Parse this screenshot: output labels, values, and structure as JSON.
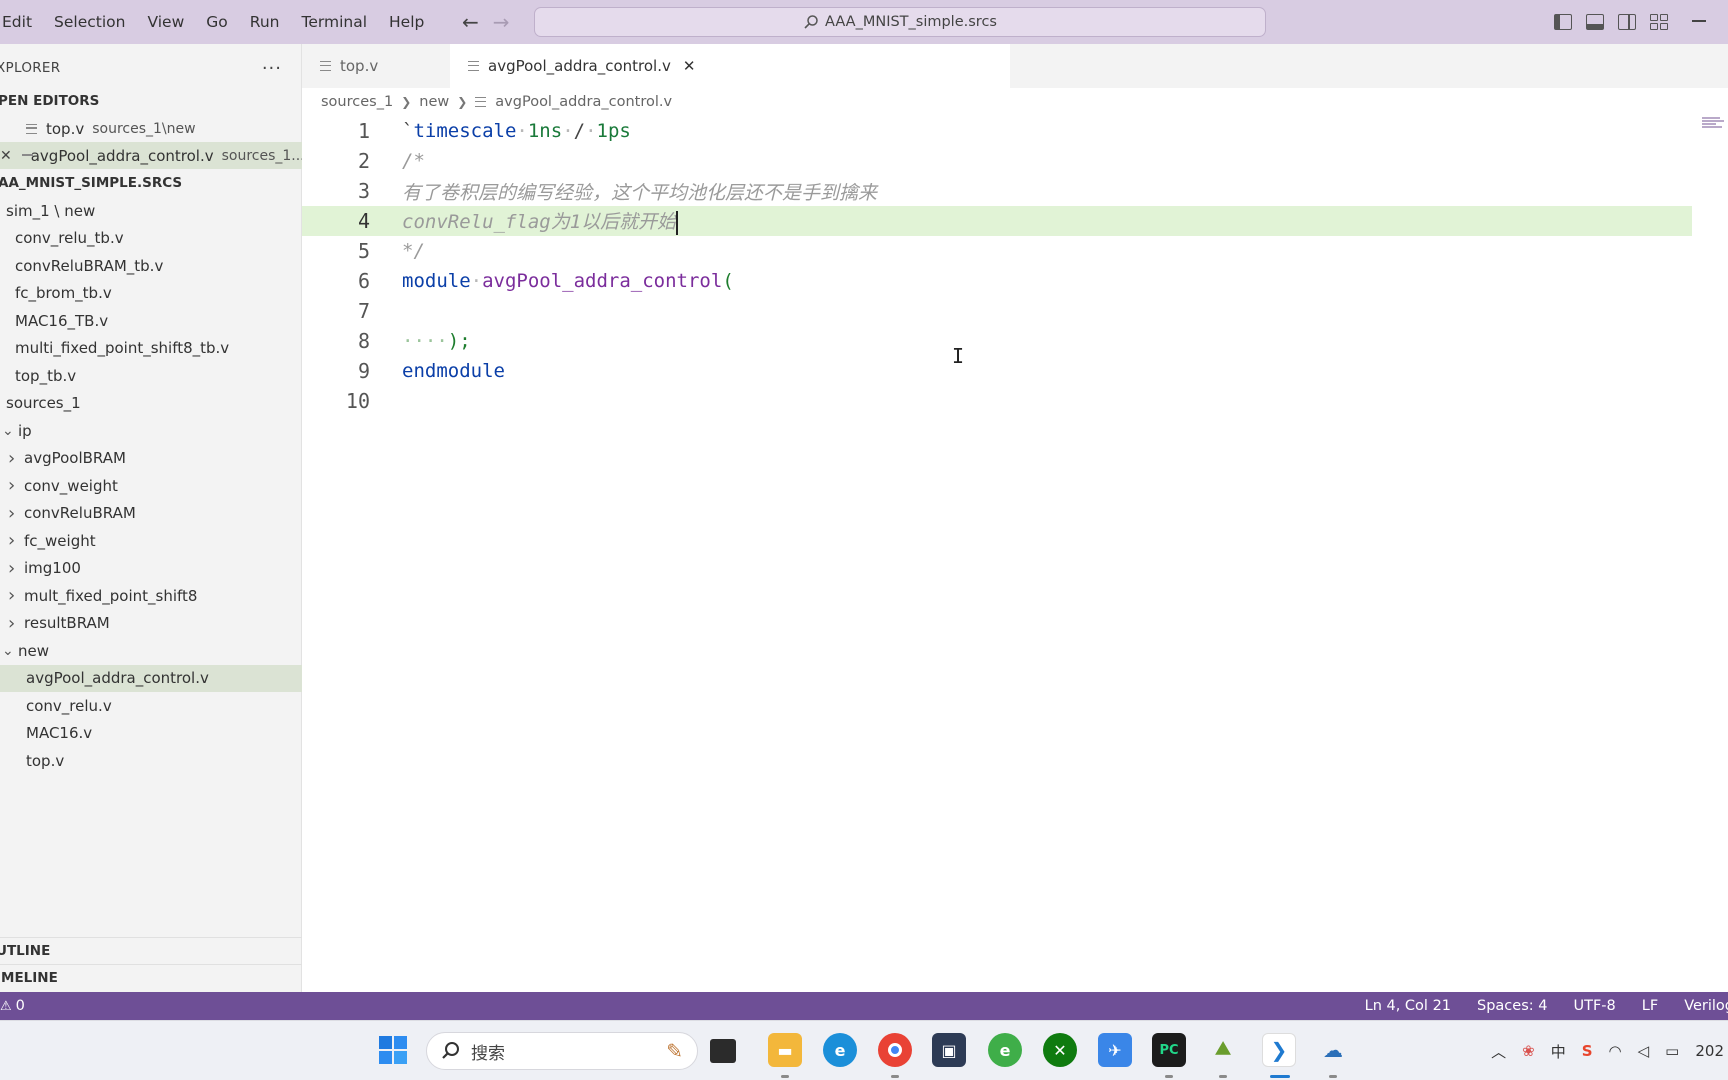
{
  "menu": [
    "Edit",
    "Selection",
    "View",
    "Go",
    "Run",
    "Terminal",
    "Help"
  ],
  "command_center": {
    "text": "AAA_MNIST_simple.srcs"
  },
  "sidebar": {
    "title": "XPLORER",
    "more": "···",
    "open_editors_label": "PEN EDITORS",
    "open_editors": [
      {
        "name": "top.v",
        "desc": "sources_1\\new"
      },
      {
        "name": "avgPool_addra_control.v",
        "desc": "sources_1..."
      }
    ],
    "workspace_label": "AA_MNIST_SIMPLE.SRCS",
    "tree": [
      {
        "label": "sim_1 \\ new",
        "indent": 6,
        "type": "folder-plain"
      },
      {
        "label": "conv_relu_tb.v",
        "indent": 15,
        "type": "file"
      },
      {
        "label": "convReluBRAM_tb.v",
        "indent": 15,
        "type": "file"
      },
      {
        "label": "fc_brom_tb.v",
        "indent": 15,
        "type": "file"
      },
      {
        "label": "MAC16_TB.v",
        "indent": 15,
        "type": "file"
      },
      {
        "label": "multi_fixed_point_shift8_tb.v",
        "indent": 15,
        "type": "file"
      },
      {
        "label": "top_tb.v",
        "indent": 15,
        "type": "file"
      },
      {
        "label": "sources_1",
        "indent": 6,
        "type": "folder-plain"
      },
      {
        "label": "ip",
        "indent": 2,
        "type": "folder-open"
      },
      {
        "label": "avgPoolBRAM",
        "indent": 8,
        "type": "folder-closed"
      },
      {
        "label": "conv_weight",
        "indent": 8,
        "type": "folder-closed"
      },
      {
        "label": "convReluBRAM",
        "indent": 8,
        "type": "folder-closed"
      },
      {
        "label": "fc_weight",
        "indent": 8,
        "type": "folder-closed"
      },
      {
        "label": "img100",
        "indent": 8,
        "type": "folder-closed"
      },
      {
        "label": "mult_fixed_point_shift8",
        "indent": 8,
        "type": "folder-closed"
      },
      {
        "label": "resultBRAM",
        "indent": 8,
        "type": "folder-closed"
      },
      {
        "label": "new",
        "indent": 2,
        "type": "folder-open"
      },
      {
        "label": "avgPool_addra_control.v",
        "indent": 26,
        "type": "file-selected"
      },
      {
        "label": "conv_relu.v",
        "indent": 26,
        "type": "file-plain"
      },
      {
        "label": "MAC16.v",
        "indent": 26,
        "type": "file-plain"
      },
      {
        "label": "top.v",
        "indent": 26,
        "type": "file-plain"
      }
    ],
    "outline_label": "UTLINE",
    "timeline_label": "IMELINE"
  },
  "tabs": [
    {
      "label": "top.v",
      "active": false
    },
    {
      "label": "avgPool_addra_control.v",
      "active": true
    }
  ],
  "breadcrumb": [
    "sources_1",
    "new",
    "avgPool_addra_control.v"
  ],
  "editor": {
    "current_line": 4,
    "line_numbers": [
      "1",
      "2",
      "3",
      "4",
      "5",
      "6",
      "7",
      "8",
      "9",
      "10"
    ],
    "lines": {
      "l1": {
        "tick": "`",
        "kw": "timescale",
        "d1": "·",
        "a": "1ns",
        "d2": "·",
        "slash": "/",
        "d3": "·",
        "b": "1ps"
      },
      "l2": {
        "text": "/*"
      },
      "l3": {
        "text": "有了卷积层的编写经验，这个平均池化层还不是手到擒来"
      },
      "l4": {
        "text": "convRelu_flag为1以后就开始"
      },
      "l5": {
        "text": "*/"
      },
      "l6": {
        "kw": "module",
        "dot": "·",
        "name": "avgPool_addra_control",
        "paren": "("
      },
      "l7": {
        "text": ""
      },
      "l8": {
        "dots": "····",
        "close": ");"
      },
      "l9": {
        "kw": "endmodule"
      },
      "l10": {
        "text": ""
      }
    }
  },
  "status": {
    "problems": "0",
    "position": "Ln 4, Col 21",
    "spaces": "Spaces: 4",
    "encoding": "UTF-8",
    "eol": "LF",
    "language": "Verilog"
  },
  "taskbar": {
    "search_placeholder": "搜索",
    "clock_partial": "202",
    "ime": "中"
  },
  "colors": {
    "titlebar": "#d8cce2",
    "statusbar": "#6e4f96",
    "current_line": "#e1f3d6",
    "selected_row": "#dbe3d4"
  }
}
